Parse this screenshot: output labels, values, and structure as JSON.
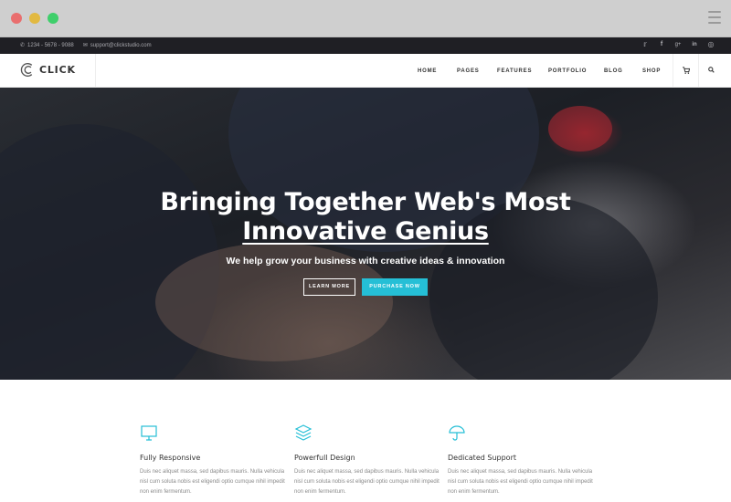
{
  "topbar": {
    "phone": "1234 - 5678 - 9088",
    "email": "support@clickstudio.com",
    "social": [
      "twitter-icon",
      "facebook-icon",
      "google-plus-icon",
      "linkedin-icon",
      "dribbble-icon"
    ]
  },
  "header": {
    "logo": "CLICK",
    "nav": [
      "HOME",
      "PAGES",
      "FEATURES",
      "PORTFOLIO",
      "BLOG",
      "SHOP"
    ]
  },
  "hero": {
    "title_line1": "Bringing Together Web's Most",
    "title_line2": "Innovative Genius",
    "subtitle": "We help grow your business with creative ideas & innovation",
    "btn_learn": "LEARN MORE",
    "btn_purchase": "PURCHASE NOW"
  },
  "features": [
    {
      "icon": "monitor-icon",
      "title": "Fully Responsive",
      "text": "Duis nec aliquet massa, sed dapibus mauris. Nulla vehicula nisl cum soluta nobis est eligendi optio cumque nihil impedit non enim fermentum."
    },
    {
      "icon": "layers-icon",
      "title": "Powerfull Design",
      "text": "Duis nec aliquet massa, sed dapibus mauris. Nulla vehicula nisl cum soluta nobis est eligendi optio cumque nihil impedit non enim fermentum."
    },
    {
      "icon": "umbrella-icon",
      "title": "Dedicated Support",
      "text": "Duis nec aliquet massa, sed dapibus mauris. Nulla vehicula nisl cum soluta nobis est eligendi optio cumque nihil impedit non enim fermentum."
    }
  ],
  "colors": {
    "accent": "#25bfd6",
    "topbar_bg": "#1f1f24"
  }
}
